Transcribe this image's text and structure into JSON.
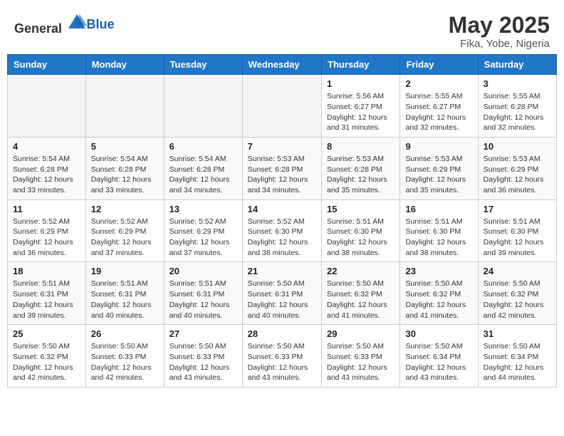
{
  "header": {
    "logo_general": "General",
    "logo_blue": "Blue",
    "month": "May 2025",
    "location": "Fika, Yobe, Nigeria"
  },
  "days_of_week": [
    "Sunday",
    "Monday",
    "Tuesday",
    "Wednesday",
    "Thursday",
    "Friday",
    "Saturday"
  ],
  "weeks": [
    [
      {
        "day": "",
        "info": ""
      },
      {
        "day": "",
        "info": ""
      },
      {
        "day": "",
        "info": ""
      },
      {
        "day": "",
        "info": ""
      },
      {
        "day": "1",
        "info": "Sunrise: 5:56 AM\nSunset: 6:27 PM\nDaylight: 12 hours\nand 31 minutes."
      },
      {
        "day": "2",
        "info": "Sunrise: 5:55 AM\nSunset: 6:27 PM\nDaylight: 12 hours\nand 32 minutes."
      },
      {
        "day": "3",
        "info": "Sunrise: 5:55 AM\nSunset: 6:28 PM\nDaylight: 12 hours\nand 32 minutes."
      }
    ],
    [
      {
        "day": "4",
        "info": "Sunrise: 5:54 AM\nSunset: 6:28 PM\nDaylight: 12 hours\nand 33 minutes."
      },
      {
        "day": "5",
        "info": "Sunrise: 5:54 AM\nSunset: 6:28 PM\nDaylight: 12 hours\nand 33 minutes."
      },
      {
        "day": "6",
        "info": "Sunrise: 5:54 AM\nSunset: 6:28 PM\nDaylight: 12 hours\nand 34 minutes."
      },
      {
        "day": "7",
        "info": "Sunrise: 5:53 AM\nSunset: 6:28 PM\nDaylight: 12 hours\nand 34 minutes."
      },
      {
        "day": "8",
        "info": "Sunrise: 5:53 AM\nSunset: 6:28 PM\nDaylight: 12 hours\nand 35 minutes."
      },
      {
        "day": "9",
        "info": "Sunrise: 5:53 AM\nSunset: 6:29 PM\nDaylight: 12 hours\nand 35 minutes."
      },
      {
        "day": "10",
        "info": "Sunrise: 5:53 AM\nSunset: 6:29 PM\nDaylight: 12 hours\nand 36 minutes."
      }
    ],
    [
      {
        "day": "11",
        "info": "Sunrise: 5:52 AM\nSunset: 6:29 PM\nDaylight: 12 hours\nand 36 minutes."
      },
      {
        "day": "12",
        "info": "Sunrise: 5:52 AM\nSunset: 6:29 PM\nDaylight: 12 hours\nand 37 minutes."
      },
      {
        "day": "13",
        "info": "Sunrise: 5:52 AM\nSunset: 6:29 PM\nDaylight: 12 hours\nand 37 minutes."
      },
      {
        "day": "14",
        "info": "Sunrise: 5:52 AM\nSunset: 6:30 PM\nDaylight: 12 hours\nand 38 minutes."
      },
      {
        "day": "15",
        "info": "Sunrise: 5:51 AM\nSunset: 6:30 PM\nDaylight: 12 hours\nand 38 minutes."
      },
      {
        "day": "16",
        "info": "Sunrise: 5:51 AM\nSunset: 6:30 PM\nDaylight: 12 hours\nand 38 minutes."
      },
      {
        "day": "17",
        "info": "Sunrise: 5:51 AM\nSunset: 6:30 PM\nDaylight: 12 hours\nand 39 minutes."
      }
    ],
    [
      {
        "day": "18",
        "info": "Sunrise: 5:51 AM\nSunset: 6:31 PM\nDaylight: 12 hours\nand 39 minutes."
      },
      {
        "day": "19",
        "info": "Sunrise: 5:51 AM\nSunset: 6:31 PM\nDaylight: 12 hours\nand 40 minutes."
      },
      {
        "day": "20",
        "info": "Sunrise: 5:51 AM\nSunset: 6:31 PM\nDaylight: 12 hours\nand 40 minutes."
      },
      {
        "day": "21",
        "info": "Sunrise: 5:50 AM\nSunset: 6:31 PM\nDaylight: 12 hours\nand 40 minutes."
      },
      {
        "day": "22",
        "info": "Sunrise: 5:50 AM\nSunset: 6:32 PM\nDaylight: 12 hours\nand 41 minutes."
      },
      {
        "day": "23",
        "info": "Sunrise: 5:50 AM\nSunset: 6:32 PM\nDaylight: 12 hours\nand 41 minutes."
      },
      {
        "day": "24",
        "info": "Sunrise: 5:50 AM\nSunset: 6:32 PM\nDaylight: 12 hours\nand 42 minutes."
      }
    ],
    [
      {
        "day": "25",
        "info": "Sunrise: 5:50 AM\nSunset: 6:32 PM\nDaylight: 12 hours\nand 42 minutes."
      },
      {
        "day": "26",
        "info": "Sunrise: 5:50 AM\nSunset: 6:33 PM\nDaylight: 12 hours\nand 42 minutes."
      },
      {
        "day": "27",
        "info": "Sunrise: 5:50 AM\nSunset: 6:33 PM\nDaylight: 12 hours\nand 43 minutes."
      },
      {
        "day": "28",
        "info": "Sunrise: 5:50 AM\nSunset: 6:33 PM\nDaylight: 12 hours\nand 43 minutes."
      },
      {
        "day": "29",
        "info": "Sunrise: 5:50 AM\nSunset: 6:33 PM\nDaylight: 12 hours\nand 43 minutes."
      },
      {
        "day": "30",
        "info": "Sunrise: 5:50 AM\nSunset: 6:34 PM\nDaylight: 12 hours\nand 43 minutes."
      },
      {
        "day": "31",
        "info": "Sunrise: 5:50 AM\nSunset: 6:34 PM\nDaylight: 12 hours\nand 44 minutes."
      }
    ]
  ]
}
